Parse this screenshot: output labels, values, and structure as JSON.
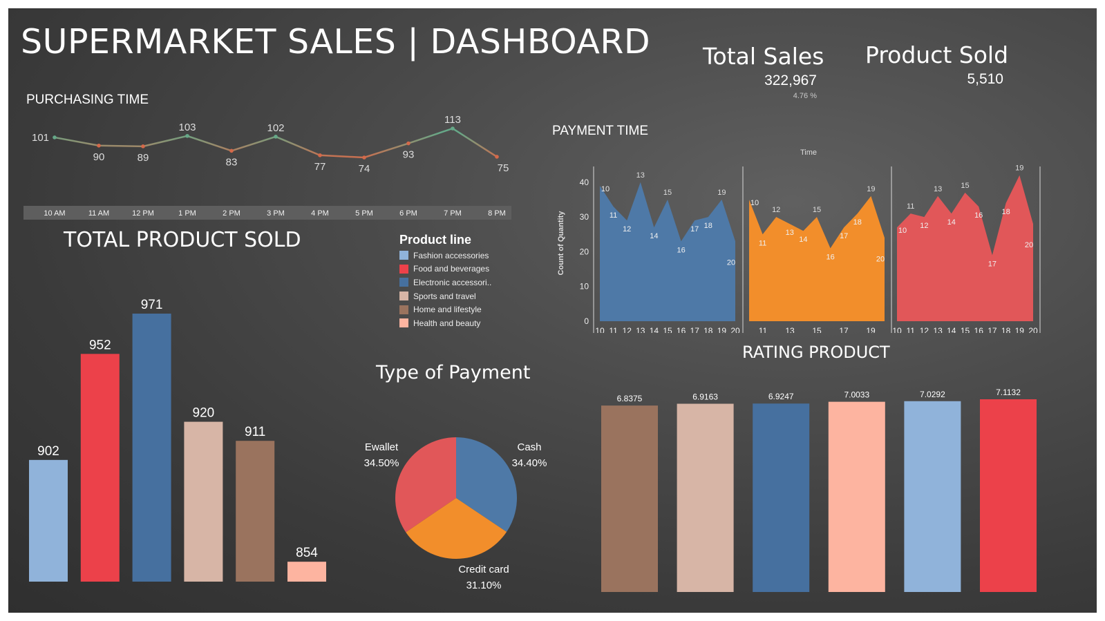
{
  "title": "SUPERMARKET SALES | DASHBOARD",
  "kpis": {
    "total_sales": {
      "label": "Total Sales",
      "value": "322,967",
      "change": "4.76 %"
    },
    "product_sold": {
      "label": "Product Sold",
      "value": "5,510"
    }
  },
  "sections": {
    "purchasing_time": "PURCHASING TIME",
    "payment_time": "PAYMENT TIME",
    "total_product_sold": "TOTAL PRODUCT SOLD",
    "type_of_payment": "Type of Payment",
    "rating_product": "RATING PRODUCT"
  },
  "legend": {
    "title": "Product line",
    "items": [
      {
        "label": "Fashion accessories",
        "color": "#90b3da"
      },
      {
        "label": "Food and beverages",
        "color": "#ec414a"
      },
      {
        "label": "Electronic accessori..",
        "color": "#46709f"
      },
      {
        "label": "Sports and travel",
        "color": "#d7b5a6"
      },
      {
        "label": "Home and lifestyle",
        "color": "#9a735e"
      },
      {
        "label": "Health and beauty",
        "color": "#fdb4a0"
      }
    ]
  },
  "chart_data": [
    {
      "id": "purchasing_time",
      "type": "line",
      "categories": [
        "10 AM",
        "11 AM",
        "12 PM",
        "1 PM",
        "2 PM",
        "3 PM",
        "4 PM",
        "5 PM",
        "6 PM",
        "7 PM",
        "8 PM"
      ],
      "values": [
        101,
        90,
        89,
        103,
        83,
        102,
        77,
        74,
        93,
        113,
        75
      ],
      "colors": {
        "high": "#66a888",
        "low": "#d4694a"
      }
    },
    {
      "id": "payment_time",
      "type": "area",
      "title": "Time",
      "ylabel": "Count of Quantity",
      "ylim": [
        0,
        45
      ],
      "yticks": [
        0,
        10,
        20,
        30,
        40
      ],
      "x": [
        10,
        11,
        12,
        13,
        14,
        15,
        16,
        17,
        18,
        19,
        20
      ],
      "series": [
        {
          "color": "#4e79a7",
          "values": [
            39,
            33,
            29,
            40,
            27,
            35,
            23,
            29,
            30,
            35,
            23
          ],
          "point_labels": [
            "10",
            "11",
            "12",
            "13",
            "14",
            "15",
            "16",
            "17",
            "18",
            "19",
            "20"
          ],
          "tick_labels": [
            "10",
            "11",
            "12",
            "13",
            "14",
            "15",
            "16",
            "17",
            "18",
            "19",
            "20"
          ]
        },
        {
          "color": "#f28e2b",
          "values": [
            35,
            25,
            30,
            28,
            26,
            30,
            21,
            27,
            31,
            36,
            24
          ],
          "point_labels": [
            "10",
            "11",
            "12",
            "13",
            "14",
            "15",
            "16",
            "17",
            "18",
            "19",
            "20"
          ],
          "tick_labels": [
            "11",
            "13",
            "15",
            "17",
            "19"
          ]
        },
        {
          "color": "#e15759",
          "values": [
            27,
            31,
            30,
            36,
            31,
            37,
            33,
            19,
            34,
            42,
            28
          ],
          "point_labels": [
            "10",
            "11",
            "12",
            "13",
            "14",
            "15",
            "16",
            "17",
            "18",
            "19",
            "20"
          ],
          "tick_labels": [
            "10",
            "11",
            "12",
            "13",
            "14",
            "15",
            "16",
            "17",
            "18",
            "19",
            "20"
          ]
        }
      ]
    },
    {
      "id": "total_product_sold",
      "type": "bar",
      "categories": [
        "Fashion accessories",
        "Food and beverages",
        "Electronic accessories",
        "Sports and travel",
        "Home and lifestyle",
        "Health and beauty"
      ],
      "values": [
        902,
        952,
        971,
        920,
        911,
        854
      ],
      "labels": [
        "902",
        "952",
        "971",
        "920",
        "911",
        "854"
      ],
      "colors": [
        "#90b3da",
        "#ec414a",
        "#46709f",
        "#d7b5a6",
        "#9a735e",
        "#fdb4a0"
      ],
      "ylim": [
        0,
        971
      ]
    },
    {
      "id": "type_of_payment",
      "type": "pie",
      "categories": [
        "Cash",
        "Credit card",
        "Ewallet"
      ],
      "values": [
        34.4,
        31.1,
        34.5
      ],
      "labels": [
        "34.40%",
        "31.10%",
        "34.50%"
      ],
      "colors": [
        "#4e79a7",
        "#f28e2b",
        "#e15759"
      ]
    },
    {
      "id": "rating_product",
      "type": "bar",
      "categories": [
        "Home and lifestyle",
        "Sports and travel",
        "Electronic accessories",
        "Health and beauty",
        "Fashion accessories",
        "Food and beverages"
      ],
      "values": [
        6.8375,
        6.9163,
        6.9247,
        7.0033,
        7.0292,
        7.1132
      ],
      "labels": [
        "6.8375",
        "6.9163",
        "6.9247",
        "7.0033",
        "7.0292",
        "7.1132"
      ],
      "colors": [
        "#9a735e",
        "#d7b5a6",
        "#46709f",
        "#fdb4a0",
        "#90b3da",
        "#ec414a"
      ],
      "ylim": [
        0,
        7.1132
      ]
    }
  ]
}
